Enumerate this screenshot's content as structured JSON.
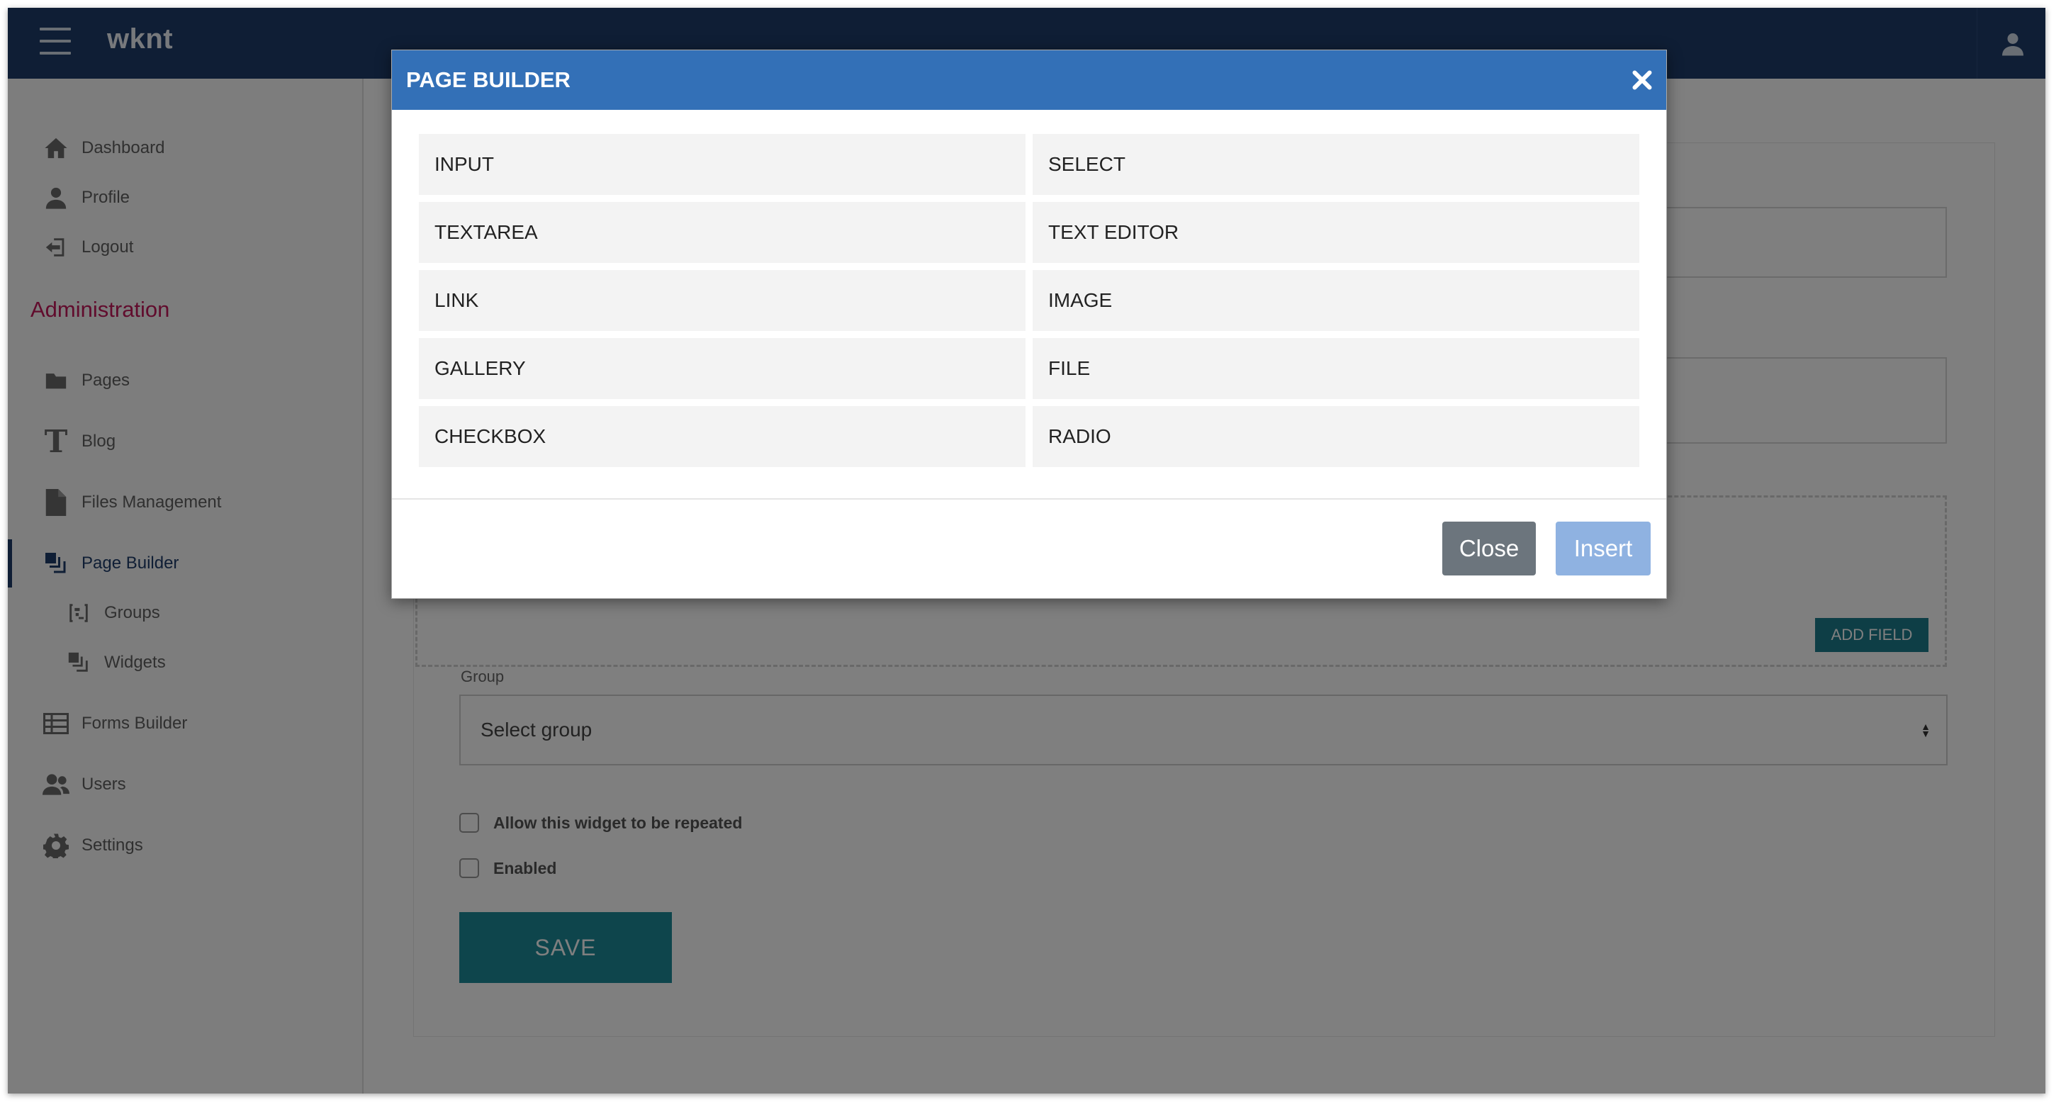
{
  "app": {
    "brand": "wknt"
  },
  "sidebar": {
    "items": [
      {
        "label": "Dashboard",
        "icon": "home-icon"
      },
      {
        "label": "Profile",
        "icon": "user-icon"
      },
      {
        "label": "Logout",
        "icon": "logout-icon"
      }
    ],
    "section_title": "Administration",
    "admin_items": [
      {
        "label": "Pages",
        "icon": "folder-icon"
      },
      {
        "label": "Blog",
        "icon": "text-icon"
      },
      {
        "label": "Files Management",
        "icon": "file-icon"
      },
      {
        "label": "Page Builder",
        "icon": "layers-icon",
        "active": true
      },
      {
        "label": "Groups",
        "icon": "groups-icon",
        "sub": true
      },
      {
        "label": "Widgets",
        "icon": "layers-icon",
        "sub": true
      },
      {
        "label": "Forms Builder",
        "icon": "table-icon"
      },
      {
        "label": "Users",
        "icon": "users-icon"
      },
      {
        "label": "Settings",
        "icon": "gear-icon"
      }
    ]
  },
  "form": {
    "add_field_label": "ADD FIELD",
    "group_label": "Group",
    "group_select_value": "Select group",
    "repeat_checkbox_label": "Allow this widget to be repeated",
    "enabled_checkbox_label": "Enabled",
    "save_label": "SAVE"
  },
  "modal": {
    "title": "PAGE BUILDER",
    "options": [
      [
        "INPUT",
        "SELECT"
      ],
      [
        "TEXTAREA",
        "TEXT EDITOR"
      ],
      [
        "LINK",
        "IMAGE"
      ],
      [
        "GALLERY",
        "FILE"
      ],
      [
        "CHECKBOX",
        "RADIO"
      ]
    ],
    "close_label": "Close",
    "insert_label": "Insert"
  },
  "colors": {
    "topbar": "#1f3c6a",
    "modal_header": "#3370b7",
    "accent_section": "#c2185b",
    "teal_button": "#1d8a99",
    "close_button": "#6c757d",
    "insert_button": "#8fb2e1"
  }
}
